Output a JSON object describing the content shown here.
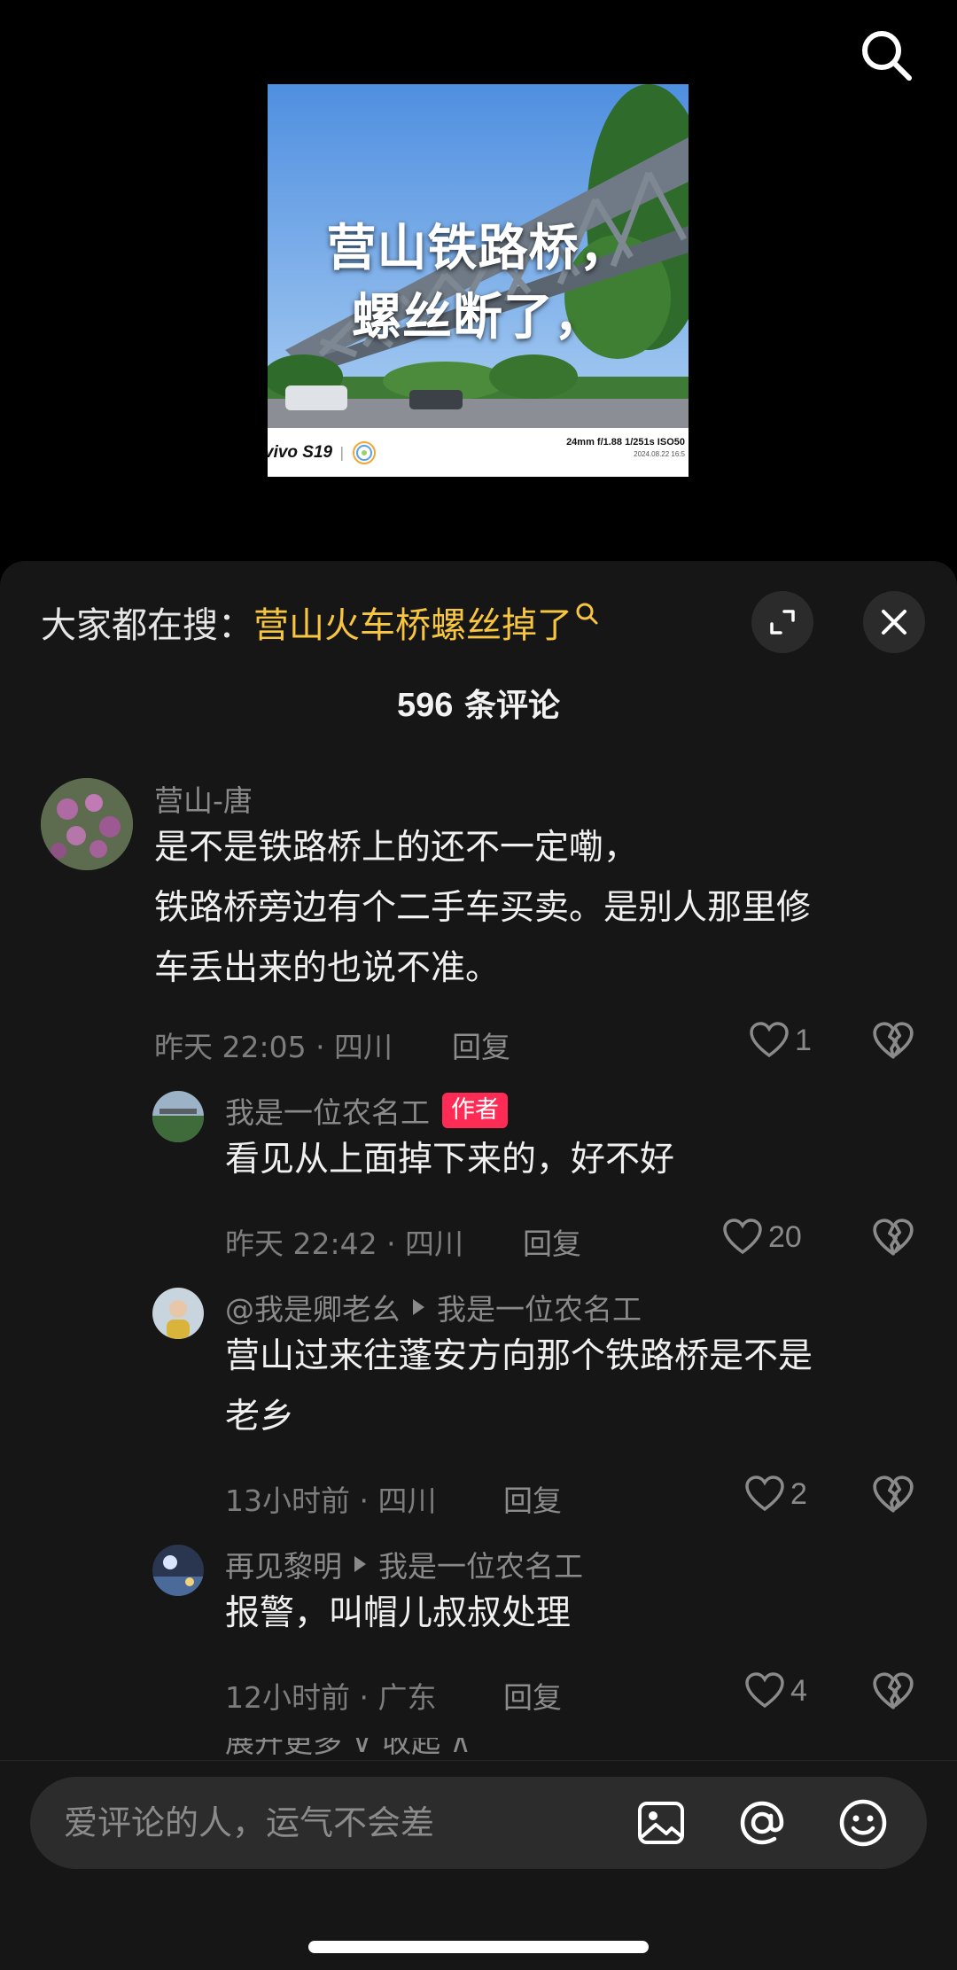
{
  "video": {
    "caption_line1": "营山铁路桥，",
    "caption_line2": "螺丝断了，",
    "brand": "vivo S19",
    "brand_sep": "|",
    "exif": "24mm f/1.88 1/251s ISO50",
    "exif_date": "2024.08.22 16:5"
  },
  "sheet": {
    "hot_label": "大家都在搜：",
    "hot_term": "营山火车桥螺丝掉了",
    "count_number": "596",
    "count_suffix": " 条评论"
  },
  "comments": [
    {
      "name": "营山-唐",
      "text_line1": "是不是铁路桥上的还不一定嘞，",
      "text_line2": "铁路桥旁边有个二手车买卖。是别人那里修",
      "text_line3": "车丢出来的也说不准。",
      "meta": "昨天 22:05 · 四川",
      "reply": "回复",
      "likes": "1"
    },
    {
      "name": "我是一位农名工",
      "badge": "作者",
      "text": "看见从上面掉下来的，好不好",
      "meta": "昨天 22:42 · 四川",
      "reply": "回复",
      "likes": "20"
    },
    {
      "name": "@我是卿老幺",
      "reply_to": "我是一位农名工",
      "text_line1": "营山过来往蓬安方向那个铁路桥是不是",
      "text_line2": "老乡",
      "meta": "13小时前 · 四川",
      "reply": "回复",
      "likes": "2"
    },
    {
      "name": "再见黎明",
      "reply_to": "我是一位农名工",
      "text": "报警，叫帽儿叔叔处理",
      "meta": "12小时前 · 广东",
      "reply": "回复",
      "likes": "4"
    }
  ],
  "expand_more": "展开更多 ∨    收起 ∧",
  "input": {
    "placeholder": "爱评论的人，运气不会差"
  },
  "icons": [
    "search-icon",
    "search-small-icon",
    "expand-icon",
    "close-icon",
    "heart-icon",
    "broken-heart-icon",
    "image-icon",
    "at-icon",
    "emoji-icon"
  ],
  "colors": {
    "sheet_bg": "#161616",
    "hot_term": "#f7c540",
    "author_badge": "#fe2c55"
  }
}
